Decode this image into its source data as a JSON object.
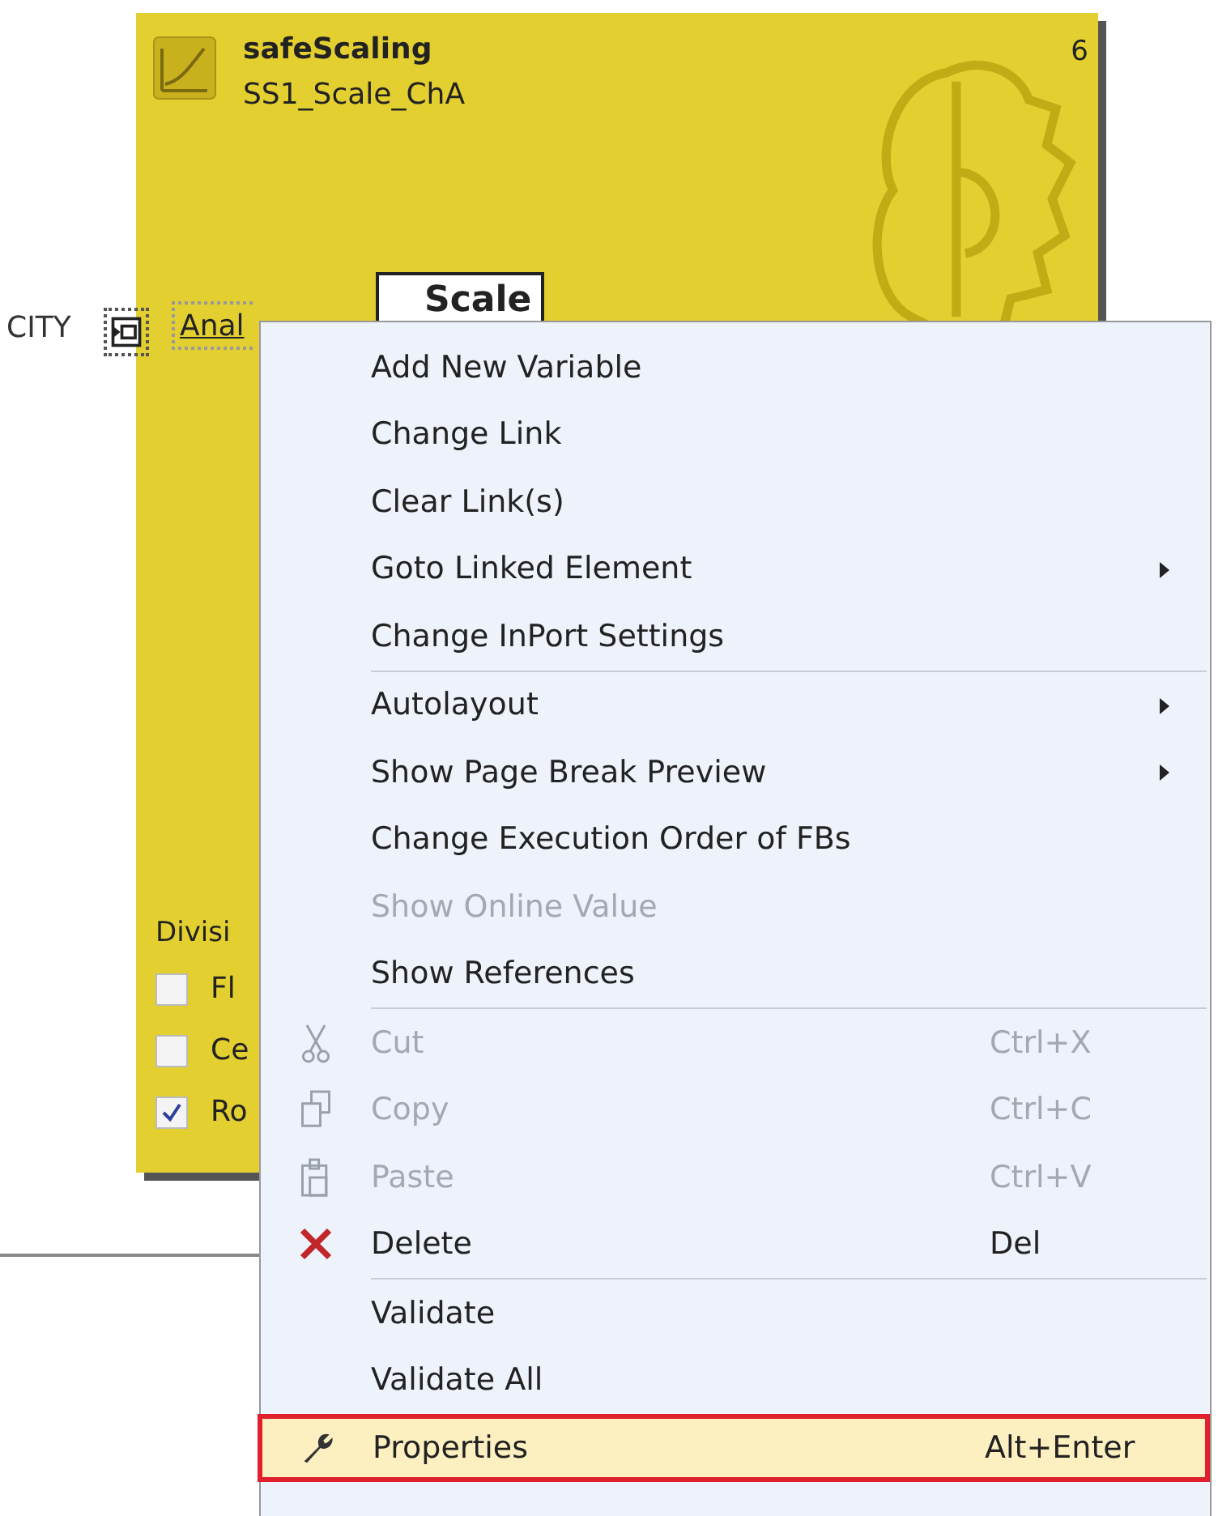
{
  "block": {
    "type_name": "safeScaling",
    "instance_name": "SS1_Scale_ChA",
    "number": "6",
    "scale_label": "Scale",
    "input_port": {
      "variable": "CITY",
      "label": "Anal"
    },
    "options_title": "Divisi",
    "options": [
      {
        "label": "Fl",
        "checked": false
      },
      {
        "label": "Ce",
        "checked": false
      },
      {
        "label": "Ro",
        "checked": true
      }
    ]
  },
  "context_menu": {
    "items": [
      {
        "kind": "item",
        "label": "Add New Variable",
        "disabled": false,
        "submenu": false,
        "selected": false
      },
      {
        "kind": "item",
        "label": "Change Link",
        "disabled": false,
        "submenu": false,
        "selected": false
      },
      {
        "kind": "item",
        "label": "Clear Link(s)",
        "disabled": false,
        "submenu": false,
        "selected": false
      },
      {
        "kind": "item",
        "label": "Goto Linked Element",
        "disabled": false,
        "submenu": true,
        "selected": false
      },
      {
        "kind": "item",
        "label": "Change InPort Settings",
        "disabled": false,
        "submenu": false,
        "selected": false
      },
      {
        "kind": "separator"
      },
      {
        "kind": "item",
        "label": "Autolayout",
        "disabled": false,
        "submenu": true,
        "selected": false
      },
      {
        "kind": "item",
        "label": "Show Page Break Preview",
        "disabled": false,
        "submenu": true,
        "selected": false
      },
      {
        "kind": "item",
        "label": "Change Execution Order of FBs",
        "disabled": false,
        "submenu": false,
        "selected": false
      },
      {
        "kind": "item",
        "label": "Show Online Value",
        "disabled": true,
        "submenu": false,
        "selected": false
      },
      {
        "kind": "item",
        "label": "Show References",
        "disabled": false,
        "submenu": false,
        "selected": false
      },
      {
        "kind": "separator"
      },
      {
        "kind": "cut",
        "label": "Cut",
        "shortcut": "Ctrl+X",
        "disabled": true,
        "submenu": false,
        "selected": false
      },
      {
        "kind": "copy",
        "label": "Copy",
        "shortcut": "Ctrl+C",
        "disabled": true,
        "submenu": false,
        "selected": false
      },
      {
        "kind": "paste",
        "label": "Paste",
        "shortcut": "Ctrl+V",
        "disabled": true,
        "submenu": false,
        "selected": false
      },
      {
        "kind": "delete",
        "label": "Delete",
        "shortcut": "Del",
        "disabled": false,
        "submenu": false,
        "selected": false
      },
      {
        "kind": "separator"
      },
      {
        "kind": "item",
        "label": "Validate",
        "disabled": false,
        "submenu": false,
        "selected": false
      },
      {
        "kind": "item",
        "label": "Validate All",
        "disabled": false,
        "submenu": false,
        "selected": false
      },
      {
        "kind": "properties",
        "label": "Properties",
        "shortcut": "Alt+Enter",
        "disabled": false,
        "submenu": false,
        "selected": true
      }
    ]
  }
}
